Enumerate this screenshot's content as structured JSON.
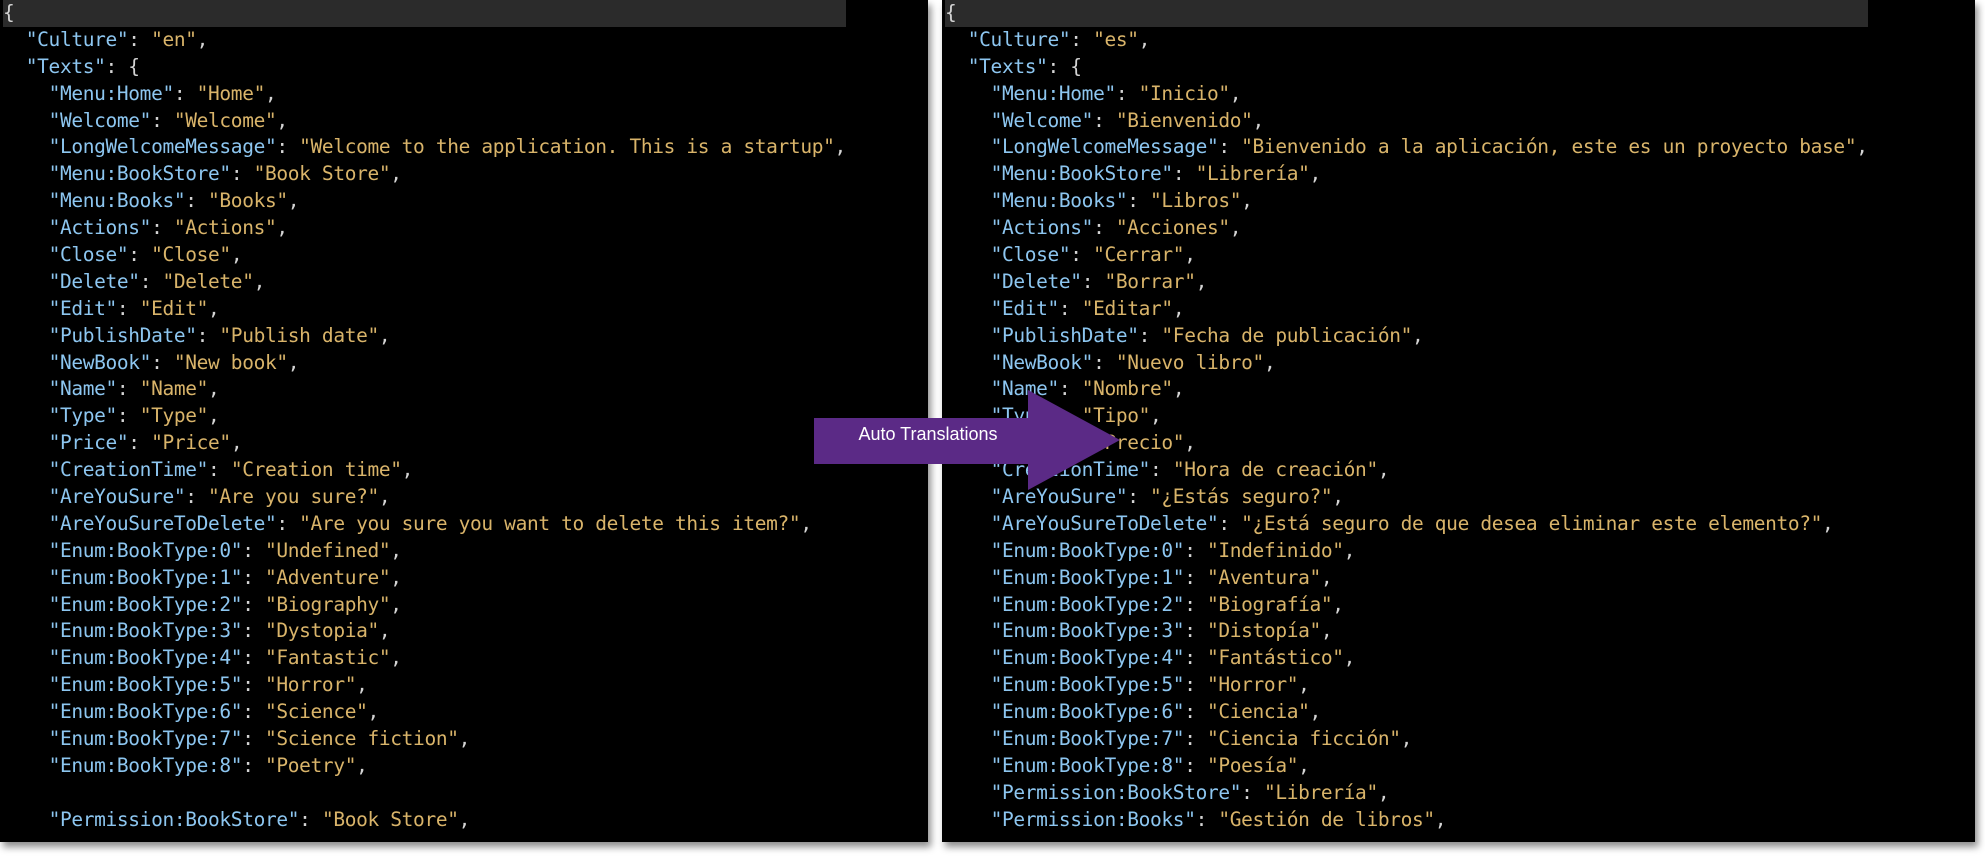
{
  "colors": {
    "background": "#000000",
    "key": "#8dc6f0",
    "string": "#d9b46a",
    "punctuation": "#d4d4d4",
    "arrow": "#5b2a86"
  },
  "left": {
    "culture_key": "Culture",
    "culture_value": "en",
    "texts_key": "Texts",
    "entries": [
      {
        "key": "Menu:Home",
        "value": "Home"
      },
      {
        "key": "Welcome",
        "value": "Welcome"
      },
      {
        "key": "LongWelcomeMessage",
        "value": "Welcome to the application. This is a startup"
      },
      {
        "key": "Menu:BookStore",
        "value": "Book Store"
      },
      {
        "key": "Menu:Books",
        "value": "Books"
      },
      {
        "key": "Actions",
        "value": "Actions"
      },
      {
        "key": "Close",
        "value": "Close"
      },
      {
        "key": "Delete",
        "value": "Delete"
      },
      {
        "key": "Edit",
        "value": "Edit"
      },
      {
        "key": "PublishDate",
        "value": "Publish date"
      },
      {
        "key": "NewBook",
        "value": "New book"
      },
      {
        "key": "Name",
        "value": "Name"
      },
      {
        "key": "Type",
        "value": "Type"
      },
      {
        "key": "Price",
        "value": "Price"
      },
      {
        "key": "CreationTime",
        "value": "Creation time"
      },
      {
        "key": "AreYouSure",
        "value": "Are you sure?"
      },
      {
        "key": "AreYouSureToDelete",
        "value": "Are you sure you want to delete this item?"
      },
      {
        "key": "Enum:BookType:0",
        "value": "Undefined"
      },
      {
        "key": "Enum:BookType:1",
        "value": "Adventure"
      },
      {
        "key": "Enum:BookType:2",
        "value": "Biography"
      },
      {
        "key": "Enum:BookType:3",
        "value": "Dystopia"
      },
      {
        "key": "Enum:BookType:4",
        "value": "Fantastic"
      },
      {
        "key": "Enum:BookType:5",
        "value": "Horror"
      },
      {
        "key": "Enum:BookType:6",
        "value": "Science"
      },
      {
        "key": "Enum:BookType:7",
        "value": "Science fiction"
      },
      {
        "key": "Enum:BookType:8",
        "value": "Poetry"
      }
    ],
    "permission_entry": {
      "key": "Permission:BookStore",
      "value": "Book Store"
    }
  },
  "right": {
    "culture_key": "Culture",
    "culture_value": "es",
    "texts_key": "Texts",
    "entries": [
      {
        "key": "Menu:Home",
        "value": "Inicio"
      },
      {
        "key": "Welcome",
        "value": "Bienvenido"
      },
      {
        "key": "LongWelcomeMessage",
        "value": "Bienvenido a la aplicación, este es un proyecto base"
      },
      {
        "key": "Menu:BookStore",
        "value": "Librería"
      },
      {
        "key": "Menu:Books",
        "value": "Libros"
      },
      {
        "key": "Actions",
        "value": "Acciones"
      },
      {
        "key": "Close",
        "value": "Cerrar"
      },
      {
        "key": "Delete",
        "value": "Borrar"
      },
      {
        "key": "Edit",
        "value": "Editar"
      },
      {
        "key": "PublishDate",
        "value": "Fecha de publicación"
      },
      {
        "key": "NewBook",
        "value": "Nuevo libro"
      },
      {
        "key": "Name",
        "value": "Nombre"
      },
      {
        "key": "Type",
        "value": "Tipo"
      },
      {
        "key": "Price",
        "value": "Precio"
      },
      {
        "key": "CreationTime",
        "value": "Hora de creación"
      },
      {
        "key": "AreYouSure",
        "value": "¿Estás seguro?"
      },
      {
        "key": "AreYouSureToDelete",
        "value": "¿Está seguro de que desea eliminar este elemento?"
      },
      {
        "key": "Enum:BookType:0",
        "value": "Indefinido"
      },
      {
        "key": "Enum:BookType:1",
        "value": "Aventura"
      },
      {
        "key": "Enum:BookType:2",
        "value": "Biografía"
      },
      {
        "key": "Enum:BookType:3",
        "value": "Distopía"
      },
      {
        "key": "Enum:BookType:4",
        "value": "Fantástico"
      },
      {
        "key": "Enum:BookType:5",
        "value": "Horror"
      },
      {
        "key": "Enum:BookType:6",
        "value": "Ciencia"
      },
      {
        "key": "Enum:BookType:7",
        "value": "Ciencia ficción"
      },
      {
        "key": "Enum:BookType:8",
        "value": "Poesía"
      },
      {
        "key": "Permission:BookStore",
        "value": "Librería"
      },
      {
        "key": "Permission:Books",
        "value": "Gestión de libros"
      }
    ]
  },
  "callout": {
    "label": "Auto Translations"
  }
}
